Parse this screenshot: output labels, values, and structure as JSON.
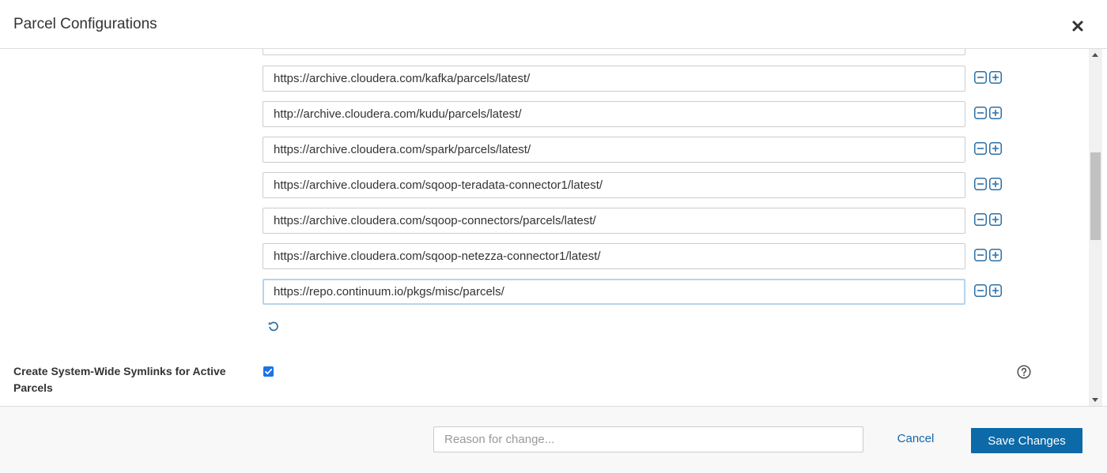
{
  "dialog": {
    "title": "Parcel Configurations"
  },
  "repository_urls": [
    "https://archive.cloudera.com/kafka/parcels/latest/",
    "http://archive.cloudera.com/kudu/parcels/latest/",
    "https://archive.cloudera.com/spark/parcels/latest/",
    "https://archive.cloudera.com/sqoop-teradata-connector1/latest/",
    "https://archive.cloudera.com/sqoop-connectors/parcels/latest/",
    "https://archive.cloudera.com/sqoop-netezza-connector1/latest/",
    "https://repo.continuum.io/pkgs/misc/parcels/"
  ],
  "symlinks_setting": {
    "label": "Create System-Wide Symlinks for Active Parcels",
    "checked": true
  },
  "footer": {
    "reason_placeholder": "Reason for change...",
    "cancel_label": "Cancel",
    "save_label": "Save Changes"
  },
  "colors": {
    "accent": "#0c6aa8",
    "icon_blue": "#2c6fa6",
    "checkbox": "#1a73e8"
  },
  "icons": [
    "close-icon",
    "remove-icon",
    "add-icon",
    "undo-icon",
    "help-icon"
  ]
}
